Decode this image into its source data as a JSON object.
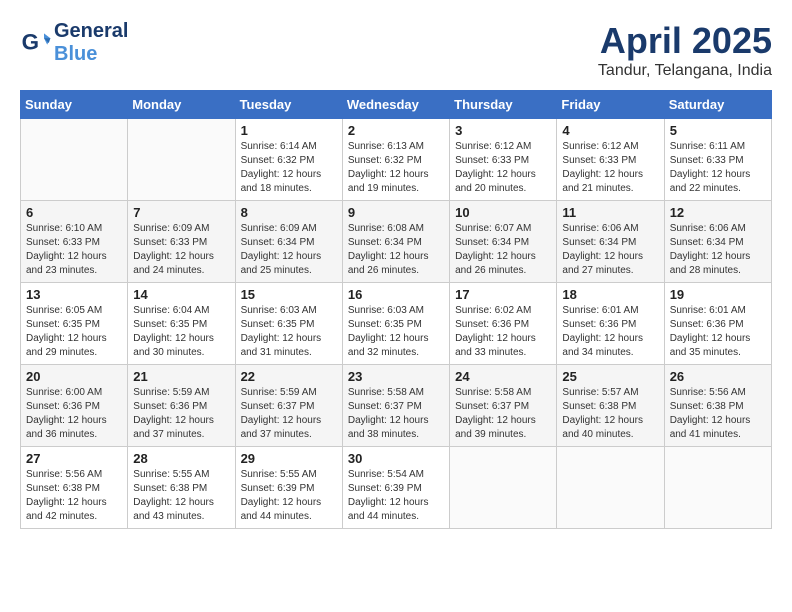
{
  "header": {
    "logo_line1": "General",
    "logo_line2": "Blue",
    "month_title": "April 2025",
    "subtitle": "Tandur, Telangana, India"
  },
  "weekdays": [
    "Sunday",
    "Monday",
    "Tuesday",
    "Wednesday",
    "Thursday",
    "Friday",
    "Saturday"
  ],
  "weeks": [
    [
      {
        "day": "",
        "info": ""
      },
      {
        "day": "",
        "info": ""
      },
      {
        "day": "1",
        "info": "Sunrise: 6:14 AM\nSunset: 6:32 PM\nDaylight: 12 hours and 18 minutes."
      },
      {
        "day": "2",
        "info": "Sunrise: 6:13 AM\nSunset: 6:32 PM\nDaylight: 12 hours and 19 minutes."
      },
      {
        "day": "3",
        "info": "Sunrise: 6:12 AM\nSunset: 6:33 PM\nDaylight: 12 hours and 20 minutes."
      },
      {
        "day": "4",
        "info": "Sunrise: 6:12 AM\nSunset: 6:33 PM\nDaylight: 12 hours and 21 minutes."
      },
      {
        "day": "5",
        "info": "Sunrise: 6:11 AM\nSunset: 6:33 PM\nDaylight: 12 hours and 22 minutes."
      }
    ],
    [
      {
        "day": "6",
        "info": "Sunrise: 6:10 AM\nSunset: 6:33 PM\nDaylight: 12 hours and 23 minutes."
      },
      {
        "day": "7",
        "info": "Sunrise: 6:09 AM\nSunset: 6:33 PM\nDaylight: 12 hours and 24 minutes."
      },
      {
        "day": "8",
        "info": "Sunrise: 6:09 AM\nSunset: 6:34 PM\nDaylight: 12 hours and 25 minutes."
      },
      {
        "day": "9",
        "info": "Sunrise: 6:08 AM\nSunset: 6:34 PM\nDaylight: 12 hours and 26 minutes."
      },
      {
        "day": "10",
        "info": "Sunrise: 6:07 AM\nSunset: 6:34 PM\nDaylight: 12 hours and 26 minutes."
      },
      {
        "day": "11",
        "info": "Sunrise: 6:06 AM\nSunset: 6:34 PM\nDaylight: 12 hours and 27 minutes."
      },
      {
        "day": "12",
        "info": "Sunrise: 6:06 AM\nSunset: 6:34 PM\nDaylight: 12 hours and 28 minutes."
      }
    ],
    [
      {
        "day": "13",
        "info": "Sunrise: 6:05 AM\nSunset: 6:35 PM\nDaylight: 12 hours and 29 minutes."
      },
      {
        "day": "14",
        "info": "Sunrise: 6:04 AM\nSunset: 6:35 PM\nDaylight: 12 hours and 30 minutes."
      },
      {
        "day": "15",
        "info": "Sunrise: 6:03 AM\nSunset: 6:35 PM\nDaylight: 12 hours and 31 minutes."
      },
      {
        "day": "16",
        "info": "Sunrise: 6:03 AM\nSunset: 6:35 PM\nDaylight: 12 hours and 32 minutes."
      },
      {
        "day": "17",
        "info": "Sunrise: 6:02 AM\nSunset: 6:36 PM\nDaylight: 12 hours and 33 minutes."
      },
      {
        "day": "18",
        "info": "Sunrise: 6:01 AM\nSunset: 6:36 PM\nDaylight: 12 hours and 34 minutes."
      },
      {
        "day": "19",
        "info": "Sunrise: 6:01 AM\nSunset: 6:36 PM\nDaylight: 12 hours and 35 minutes."
      }
    ],
    [
      {
        "day": "20",
        "info": "Sunrise: 6:00 AM\nSunset: 6:36 PM\nDaylight: 12 hours and 36 minutes."
      },
      {
        "day": "21",
        "info": "Sunrise: 5:59 AM\nSunset: 6:36 PM\nDaylight: 12 hours and 37 minutes."
      },
      {
        "day": "22",
        "info": "Sunrise: 5:59 AM\nSunset: 6:37 PM\nDaylight: 12 hours and 37 minutes."
      },
      {
        "day": "23",
        "info": "Sunrise: 5:58 AM\nSunset: 6:37 PM\nDaylight: 12 hours and 38 minutes."
      },
      {
        "day": "24",
        "info": "Sunrise: 5:58 AM\nSunset: 6:37 PM\nDaylight: 12 hours and 39 minutes."
      },
      {
        "day": "25",
        "info": "Sunrise: 5:57 AM\nSunset: 6:38 PM\nDaylight: 12 hours and 40 minutes."
      },
      {
        "day": "26",
        "info": "Sunrise: 5:56 AM\nSunset: 6:38 PM\nDaylight: 12 hours and 41 minutes."
      }
    ],
    [
      {
        "day": "27",
        "info": "Sunrise: 5:56 AM\nSunset: 6:38 PM\nDaylight: 12 hours and 42 minutes."
      },
      {
        "day": "28",
        "info": "Sunrise: 5:55 AM\nSunset: 6:38 PM\nDaylight: 12 hours and 43 minutes."
      },
      {
        "day": "29",
        "info": "Sunrise: 5:55 AM\nSunset: 6:39 PM\nDaylight: 12 hours and 44 minutes."
      },
      {
        "day": "30",
        "info": "Sunrise: 5:54 AM\nSunset: 6:39 PM\nDaylight: 12 hours and 44 minutes."
      },
      {
        "day": "",
        "info": ""
      },
      {
        "day": "",
        "info": ""
      },
      {
        "day": "",
        "info": ""
      }
    ]
  ]
}
